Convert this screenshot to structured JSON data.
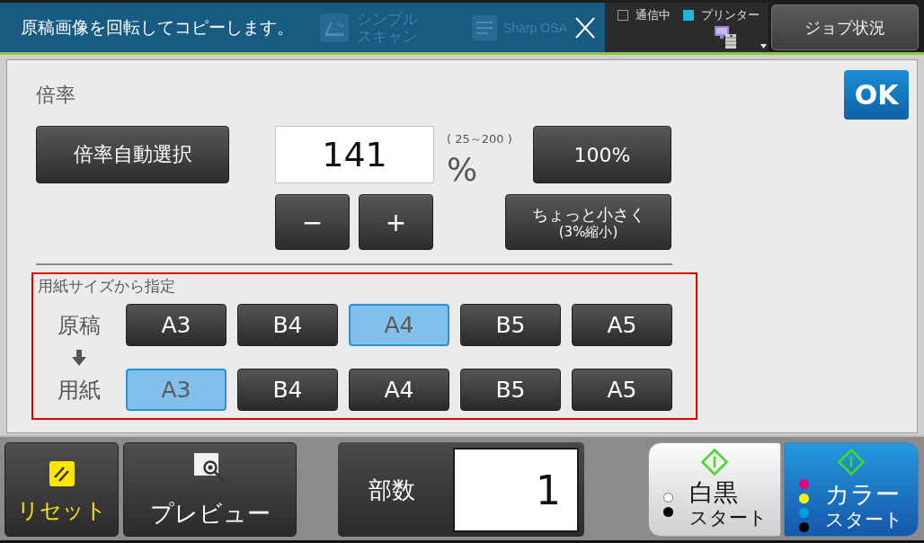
{
  "top_bar": {
    "notice": {
      "message": "原稿画像を回転してコピーします。"
    },
    "shortcuts": [
      {
        "kind": "scan",
        "label_lines": [
          "シンプル",
          "スキャン"
        ]
      },
      {
        "kind": "app",
        "label_lines": [
          "Sharp OSA"
        ]
      }
    ],
    "status": {
      "indicators": [
        {
          "label": "通信中",
          "on": false
        },
        {
          "label": "プリンター",
          "on": true
        }
      ]
    },
    "job_status_button": "ジョブ状況"
  },
  "magnification": {
    "title": "倍率",
    "ok_button": "OK",
    "auto_select_button": "倍率自動選択",
    "value": "141",
    "range": "( 25～200 )",
    "unit": "%",
    "preset_button": "100%",
    "minus_button": "−",
    "plus_button": "+",
    "slightly_smaller_button": [
      "ちょっと小さく",
      "(3%縮小)"
    ]
  },
  "paper_size": {
    "title": "用紙サイズから指定",
    "original_label": "原稿",
    "paper_label": "用紙",
    "original_sizes": [
      {
        "label": "A3",
        "selected": false
      },
      {
        "label": "B4",
        "selected": false
      },
      {
        "label": "A4",
        "selected": true
      },
      {
        "label": "B5",
        "selected": false
      },
      {
        "label": "A5",
        "selected": false
      }
    ],
    "paper_sizes": [
      {
        "label": "A3",
        "selected": true
      },
      {
        "label": "B4",
        "selected": false
      },
      {
        "label": "A4",
        "selected": false
      },
      {
        "label": "B5",
        "selected": false
      },
      {
        "label": "A5",
        "selected": false
      }
    ]
  },
  "bottom_bar": {
    "reset_button": "リセット",
    "preview_button": "プレビュー",
    "copies": {
      "label": "部数",
      "value": "1"
    },
    "start_buttons": [
      {
        "kind": "mono",
        "title": "白黒",
        "subtitle": "スタート",
        "dots": [
          {
            "color": "#ffffff"
          },
          {
            "color": "#000000"
          }
        ]
      },
      {
        "kind": "color",
        "title": "カラー",
        "subtitle": "スタート",
        "dots": [
          {
            "color": "#e4007f"
          },
          {
            "color": "#fff100"
          },
          {
            "color": "#00a0e9"
          },
          {
            "color": "#000000"
          }
        ]
      }
    ]
  }
}
